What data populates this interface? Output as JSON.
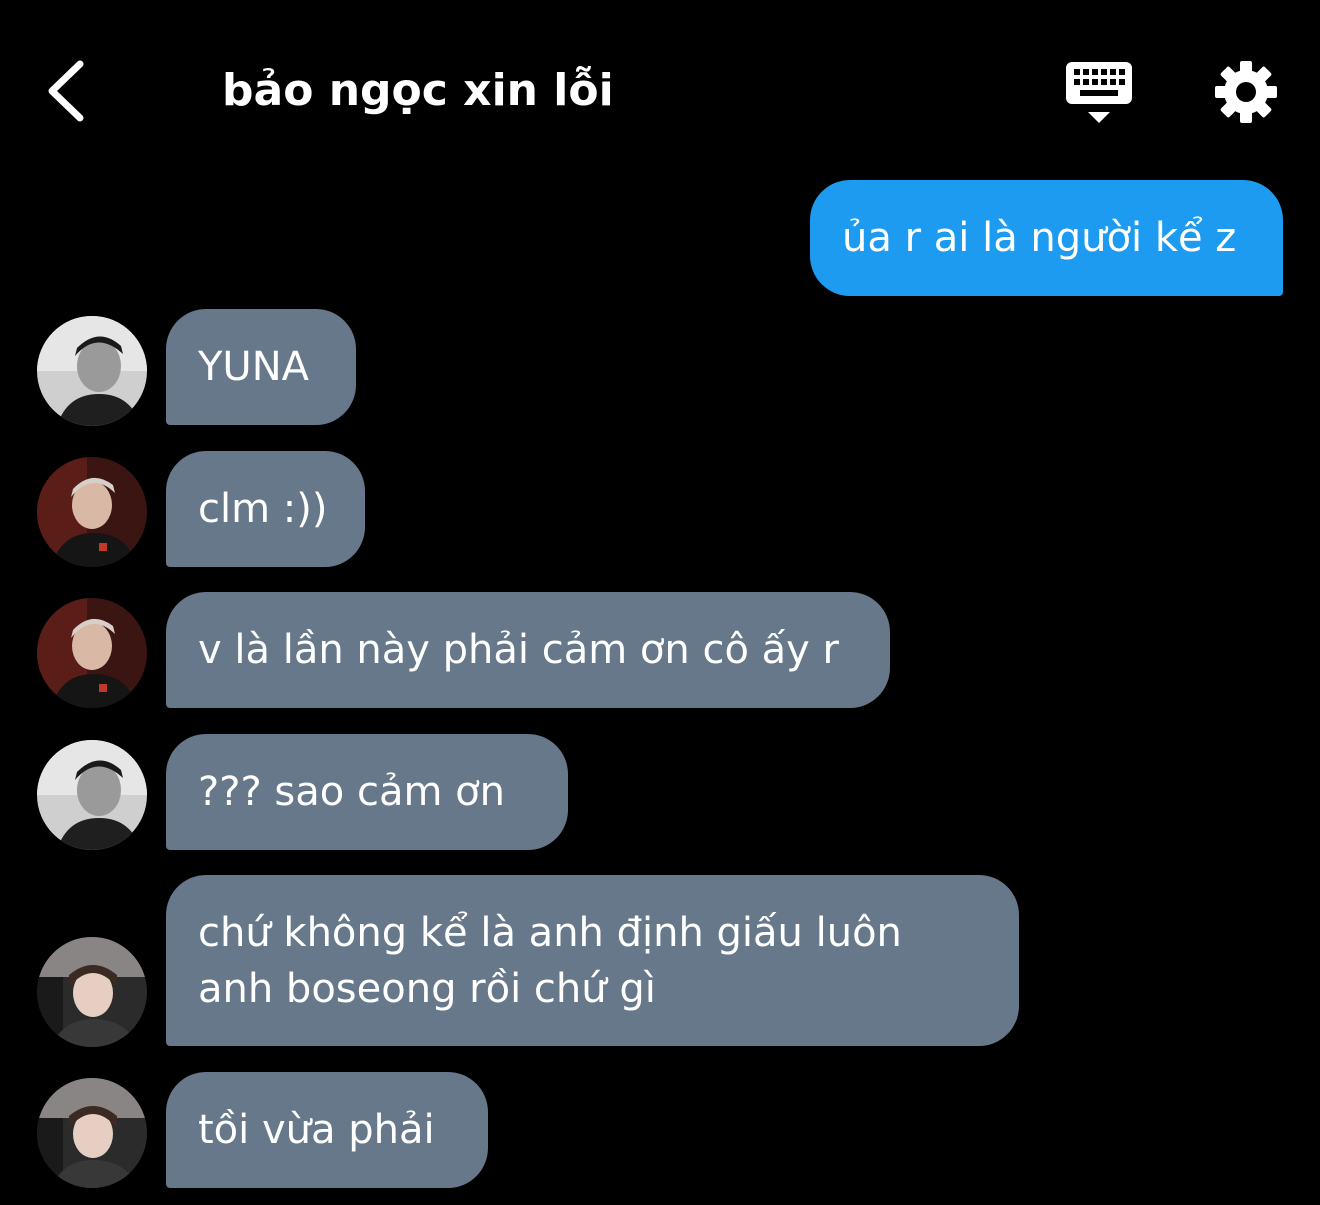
{
  "header": {
    "title": "bảo ngọc xin lỗi",
    "back_icon": "chevron-left-icon",
    "keyboard_icon": "keyboard-icon",
    "settings_icon": "gear-icon"
  },
  "colors": {
    "background": "#000000",
    "outgoing_bubble": "#1d9bf0",
    "incoming_bubble": "#66788a",
    "text": "#ffffff"
  },
  "messages": [
    {
      "direction": "outgoing",
      "text": "ủa r ai là người kể z"
    },
    {
      "direction": "incoming",
      "avatar": "avatar-1",
      "text": "YUNA"
    },
    {
      "direction": "incoming",
      "avatar": "avatar-2",
      "text": "clm :))"
    },
    {
      "direction": "incoming",
      "avatar": "avatar-2",
      "text": "v là lần này phải cảm ơn cô ấy r"
    },
    {
      "direction": "incoming",
      "avatar": "avatar-1",
      "text": "??? sao cảm ơn"
    },
    {
      "direction": "incoming",
      "avatar": "avatar-3",
      "lines": [
        "chứ không kể là anh định giấu luôn",
        "anh boseong rồi chứ gì"
      ]
    },
    {
      "direction": "incoming",
      "avatar": "avatar-3",
      "text": "tồi vừa phải"
    }
  ]
}
